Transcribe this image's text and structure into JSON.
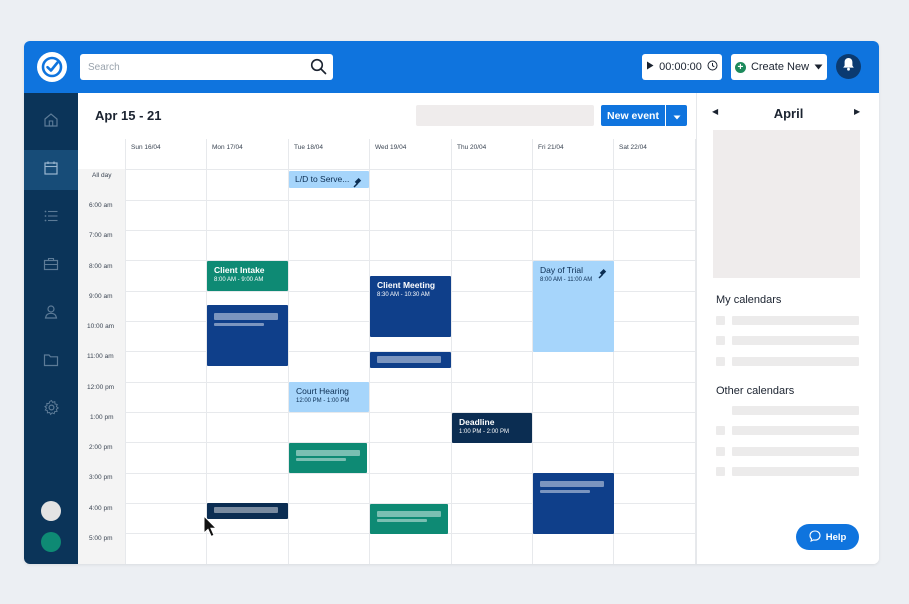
{
  "topbar": {
    "search_placeholder": "Search",
    "timer": "00:00:00",
    "create_new": "Create New"
  },
  "sidebar": {
    "items": [
      "home-icon",
      "calendar-icon",
      "list-icon",
      "briefcase-icon",
      "person-icon",
      "folder-icon",
      "settings-icon"
    ],
    "active": "calendar-icon",
    "user_colors": [
      "#e3e3e3",
      "#0e8a74"
    ]
  },
  "calendar": {
    "range": "Apr 15 - 21",
    "new_event": "New event",
    "days": [
      "Sun 16/04",
      "Mon 17/04",
      "Tue 18/04",
      "Wed 19/04",
      "Thu 20/04",
      "Fri 21/04",
      "Sat 22/04"
    ],
    "all_day_label": "All day",
    "times": [
      "6:00 am",
      "7:00 am",
      "8:00 am",
      "9:00 am",
      "10:00 am",
      "11:00 am",
      "12:00 pm",
      "1:00 pm",
      "2:00 pm",
      "3:00 pm",
      "4:00 pm",
      "5:00 pm"
    ],
    "events": {
      "ld_serve": {
        "title": "L/D to Serve..."
      },
      "client_intake": {
        "title": "Client Intake",
        "time": "8:00 AM - 9:00 AM"
      },
      "client_meeting": {
        "title": "Client Meeting",
        "time": "8:30 AM - 10:30 AM"
      },
      "day_of_trial": {
        "title": "Day of Trial",
        "time": "8:00 AM - 11:00 AM"
      },
      "court_hearing": {
        "title": "Court Hearing",
        "time": "12:00 PM - 1:00 PM"
      },
      "deadline": {
        "title": "Deadline",
        "time": "1:00 PM - 2:00 PM"
      }
    }
  },
  "colors": {
    "brand_blue": "#0f74de",
    "sidebar_navy": "#0b3459",
    "event_dark_blue": "#0f3f8a",
    "event_navy": "#0b2d52",
    "event_teal": "#0e8a74",
    "event_light_blue": "#a6d5fb"
  },
  "right_panel": {
    "month": "April",
    "prev": "◀",
    "next": "▶",
    "my_calendars": "My calendars",
    "other_calendars": "Other calendars",
    "help": "Help"
  }
}
